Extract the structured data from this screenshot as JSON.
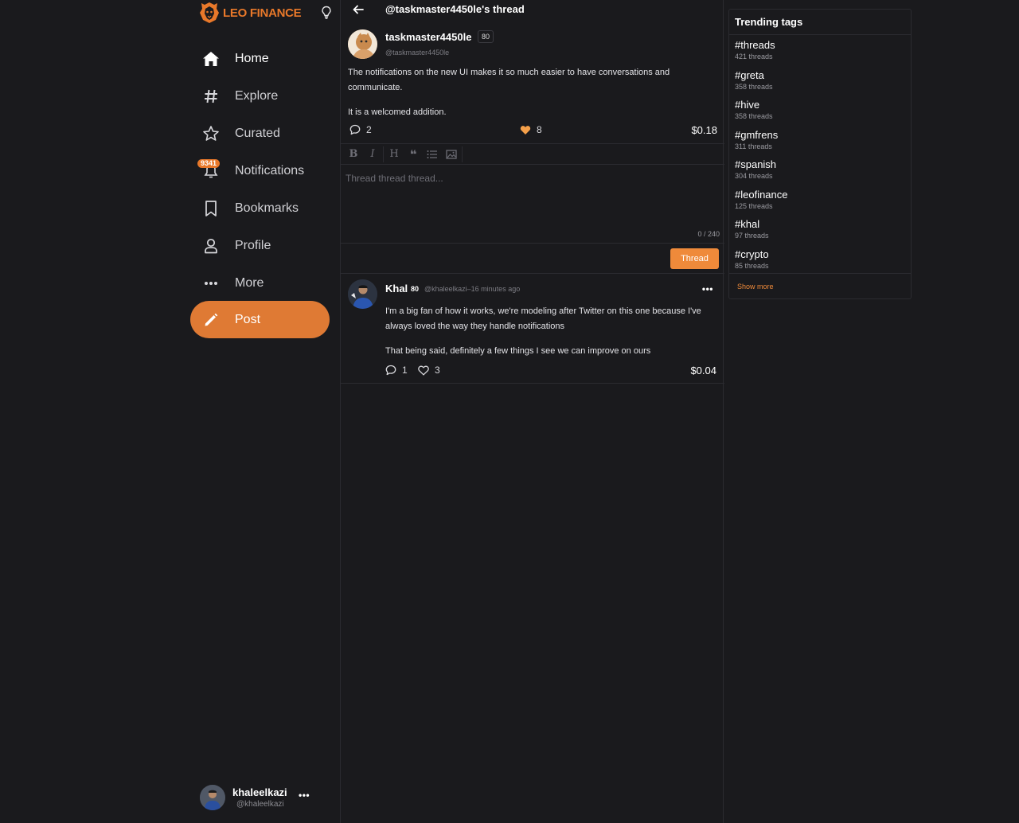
{
  "brand": {
    "leo": "LEO",
    "finance": "FINANCE"
  },
  "sidebar": {
    "items": [
      {
        "label": "Home",
        "icon": "home-icon"
      },
      {
        "label": "Explore",
        "icon": "hash-icon"
      },
      {
        "label": "Curated",
        "icon": "star-icon"
      },
      {
        "label": "Notifications",
        "icon": "bell-icon",
        "badge": "9341"
      },
      {
        "label": "Bookmarks",
        "icon": "bookmark-icon"
      },
      {
        "label": "Profile",
        "icon": "user-icon"
      },
      {
        "label": "More",
        "icon": "more-icon"
      }
    ],
    "post_label": "Post"
  },
  "account": {
    "name": "khaleelkazi",
    "handle": "@khaleelkazi"
  },
  "thread": {
    "title": "@taskmaster4450le's thread",
    "post": {
      "author": "taskmaster4450le",
      "reputation": "80",
      "handle": "@taskmaster4450le",
      "body": [
        "The notifications on the new UI makes it so much easier to have conversations and communicate.",
        "It is a welcomed addition."
      ],
      "comments": "2",
      "likes": "8",
      "payout": "$0.18"
    },
    "editor": {
      "placeholder": "Thread thread thread...",
      "counter": "0 / 240",
      "submit_label": "Thread"
    },
    "reply": {
      "author": "Khal",
      "reputation": "80",
      "meta": "@khaleelkazi–16 minutes ago",
      "body": [
        "I'm a big fan of how it works, we're modeling after Twitter on this one because I've always loved the way they handle notifications",
        "That being said, definitely a few things I see we can improve on ours"
      ],
      "comments": "1",
      "likes": "3",
      "payout": "$0.04"
    }
  },
  "trending": {
    "title": "Trending tags",
    "tags": [
      {
        "name": "#threads",
        "count": "421 threads"
      },
      {
        "name": "#greta",
        "count": "358 threads"
      },
      {
        "name": "#hive",
        "count": "358 threads"
      },
      {
        "name": "#gmfrens",
        "count": "311 threads"
      },
      {
        "name": "#spanish",
        "count": "304 threads"
      },
      {
        "name": "#leofinance",
        "count": "125 threads"
      },
      {
        "name": "#khal",
        "count": "97 threads"
      },
      {
        "name": "#crypto",
        "count": "85 threads"
      }
    ],
    "show_more": "Show more"
  },
  "colors": {
    "accent": "#df7a34",
    "background": "#1a1a1d",
    "border": "#2b2b30"
  }
}
